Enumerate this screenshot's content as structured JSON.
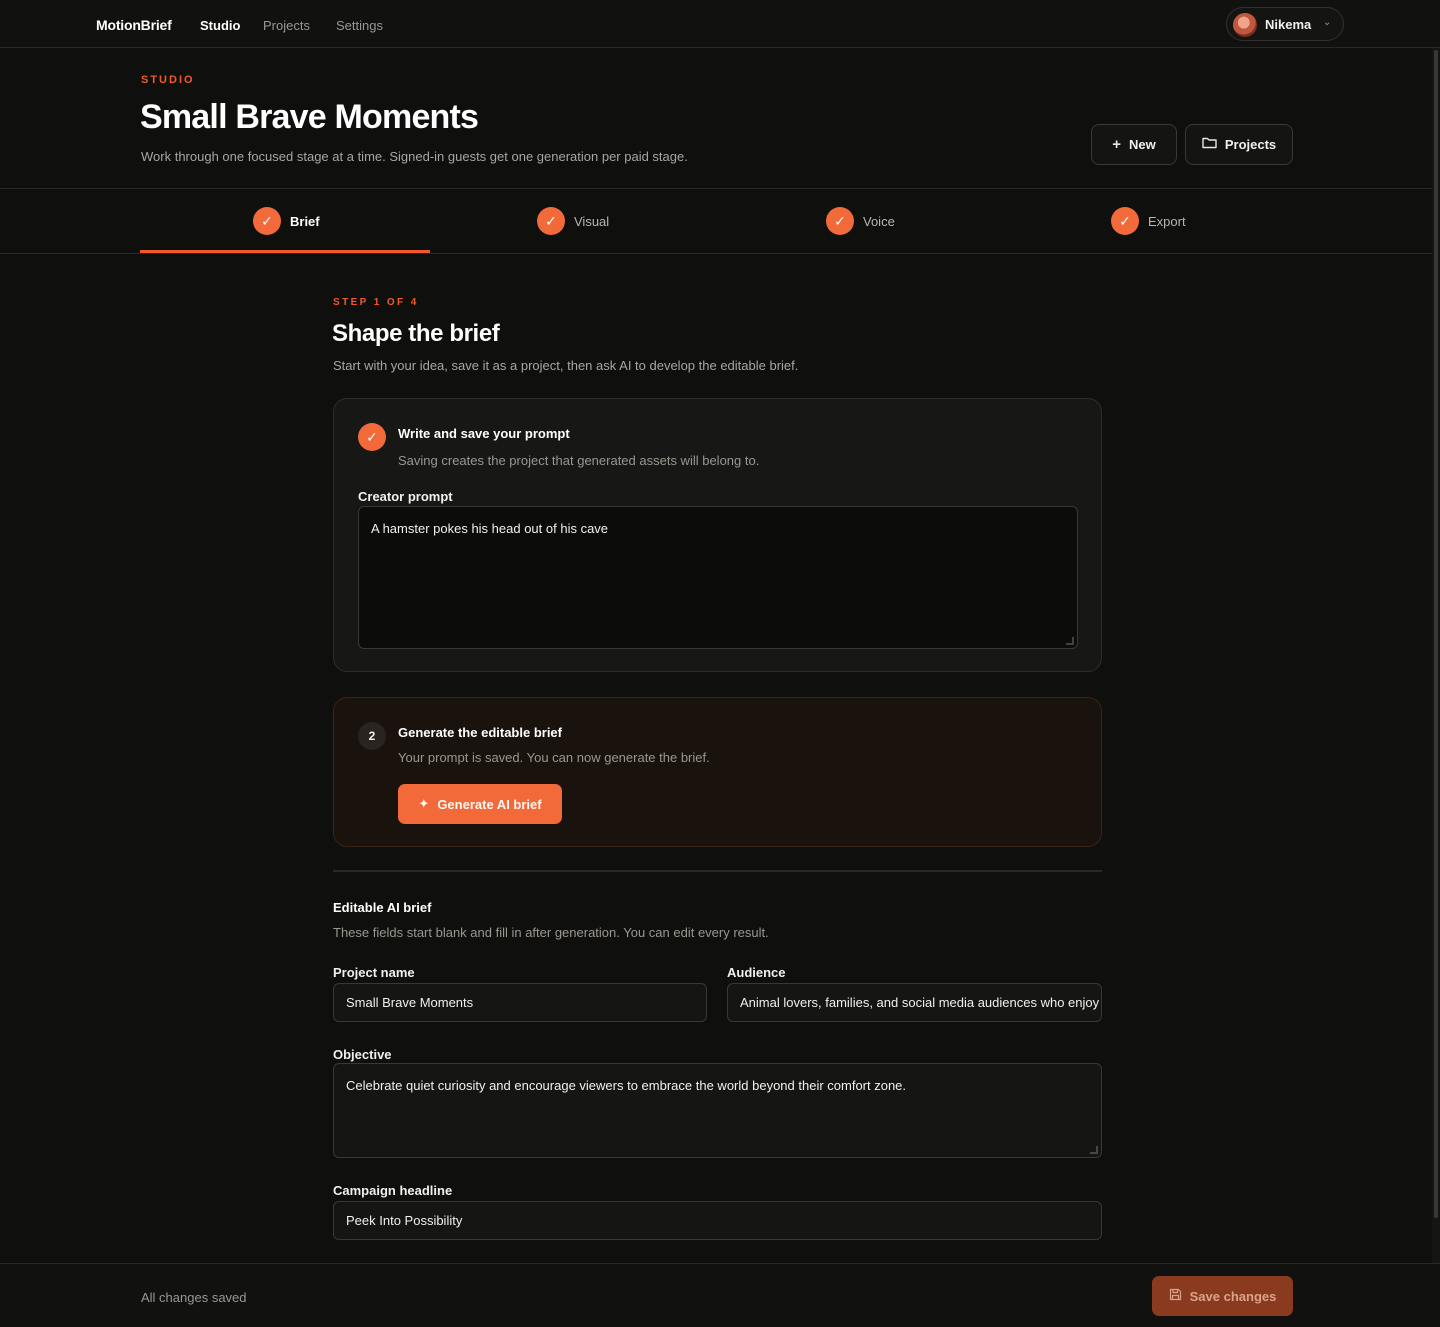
{
  "nav": {
    "brand": "MotionBrief",
    "links": [
      "Studio",
      "Projects",
      "Settings"
    ],
    "user": "Nikema"
  },
  "header": {
    "eyebrow": "STUDIO",
    "title": "Small Brave Moments",
    "subtitle": "Work through one focused stage at a time. Signed-in guests get one generation per paid stage.",
    "new_label": "New",
    "projects_label": "Projects"
  },
  "steps": [
    {
      "label": "Brief",
      "done": true,
      "active": true
    },
    {
      "label": "Visual",
      "done": true
    },
    {
      "label": "Voice",
      "done": true
    },
    {
      "label": "Export",
      "done": true
    }
  ],
  "main": {
    "eyebrow": "STEP 1 OF 4",
    "title": "Shape the brief",
    "subtitle": "Start with your idea, save it as a project, then ask AI to develop the editable brief."
  },
  "card1": {
    "title": "Write and save your prompt",
    "desc": "Saving creates the project that generated assets will belong to.",
    "field_label": "Creator prompt",
    "prompt_value": "A hamster pokes his head out of his cave"
  },
  "card2": {
    "number": "2",
    "title": "Generate the editable brief",
    "desc": "Your prompt is saved. You can now generate the brief.",
    "button_label": "Generate AI brief"
  },
  "brief": {
    "title": "Editable AI brief",
    "desc": "These fields start blank and fill in after generation. You can edit every result.",
    "project_name_label": "Project name",
    "project_name_value": "Small Brave Moments",
    "audience_label": "Audience",
    "audience_value": "Animal lovers, families, and social media audiences who enjoy gentle, uplifting stories",
    "objective_label": "Objective",
    "objective_value": "Celebrate quiet curiosity and encourage viewers to embrace the world beyond their comfort zone.",
    "headline_label": "Campaign headline",
    "headline_value": "Peek Into Possibility"
  },
  "footer": {
    "status": "All changes saved",
    "save_label": "Save changes"
  },
  "colors": {
    "accent": "#f26a3a",
    "background": "#0f0f0e"
  },
  "icons": [
    "check-icon",
    "plus-icon",
    "folder-icon",
    "sparkle-icon",
    "save-icon",
    "chevron-down-icon"
  ]
}
